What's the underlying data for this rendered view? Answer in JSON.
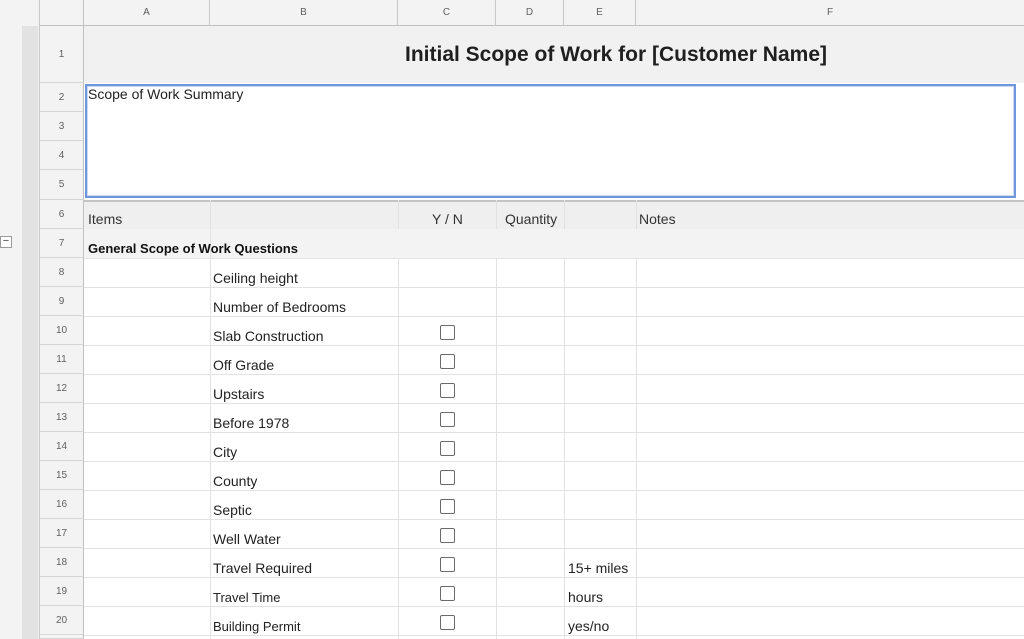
{
  "column_headers": [
    "A",
    "B",
    "C",
    "D",
    "E",
    "F"
  ],
  "row_headers": [
    "1",
    "2",
    "3",
    "4",
    "5",
    "6",
    "7",
    "8",
    "9",
    "10",
    "11",
    "12",
    "13",
    "14",
    "15",
    "16",
    "17",
    "18",
    "19",
    "20"
  ],
  "outline": {
    "collapse_symbol": "−"
  },
  "title": "Initial Scope of Work for [Customer Name]",
  "summary": {
    "label": "Scope of Work Summary"
  },
  "table_header": {
    "items": "Items",
    "yn": "Y / N",
    "quantity": "Quantity",
    "notes": "Notes"
  },
  "section": {
    "title": "General Scope of Work Questions"
  },
  "items": [
    {
      "label": "Ceiling height"
    },
    {
      "label": "Number of Bedrooms"
    },
    {
      "label": "Slab Construction",
      "checkbox": true,
      "checked": false
    },
    {
      "label": "Off Grade",
      "checkbox": true,
      "checked": false
    },
    {
      "label": "Upstairs",
      "checkbox": true,
      "checked": false
    },
    {
      "label": "Before 1978",
      "checkbox": true,
      "checked": false
    },
    {
      "label": "City",
      "checkbox": true,
      "checked": false
    },
    {
      "label": "County",
      "checkbox": true,
      "checked": false
    },
    {
      "label": "Septic",
      "checkbox": true,
      "checked": false
    },
    {
      "label": "Well Water",
      "checkbox": true,
      "checked": false
    },
    {
      "label": "Travel Required",
      "checkbox": true,
      "checked": false,
      "unit": "15+ miles"
    },
    {
      "label": "Travel Time",
      "checkbox": true,
      "checked": false,
      "unit": "hours"
    },
    {
      "label": "Building Permit",
      "checkbox": true,
      "checked": false,
      "unit": "yes/no"
    }
  ]
}
